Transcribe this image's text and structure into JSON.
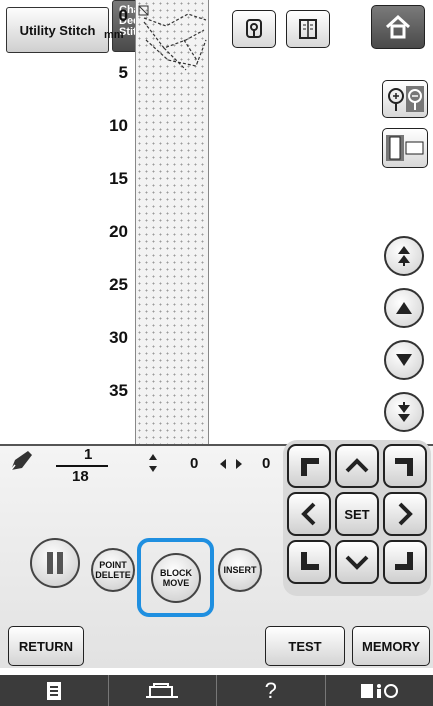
{
  "tabs": {
    "utility": "Utility Stitch",
    "character_line1": "Character",
    "character_line2": "Decorative",
    "character_line3": "Stitch"
  },
  "ruler": {
    "unit": "mm",
    "ticks": [
      "0",
      "5",
      "10",
      "15",
      "20",
      "25",
      "30",
      "35"
    ]
  },
  "counters": {
    "numerator": "1",
    "denominator": "18",
    "vertical": "0",
    "horizontal": "0"
  },
  "pad": {
    "set": "SET"
  },
  "edit_buttons": {
    "point_delete_1": "POINT",
    "point_delete_2": "DELETE",
    "block_move_1": "BLOCK",
    "block_move_2": "MOVE",
    "insert": "INSERT"
  },
  "footer_buttons": {
    "return": "RETURN",
    "test": "TEST",
    "memory": "MEMORY"
  },
  "bottom_bar": {
    "help": "?"
  },
  "colors": {
    "highlight": "#1f8fe0",
    "bar": "#3b3b3b"
  }
}
